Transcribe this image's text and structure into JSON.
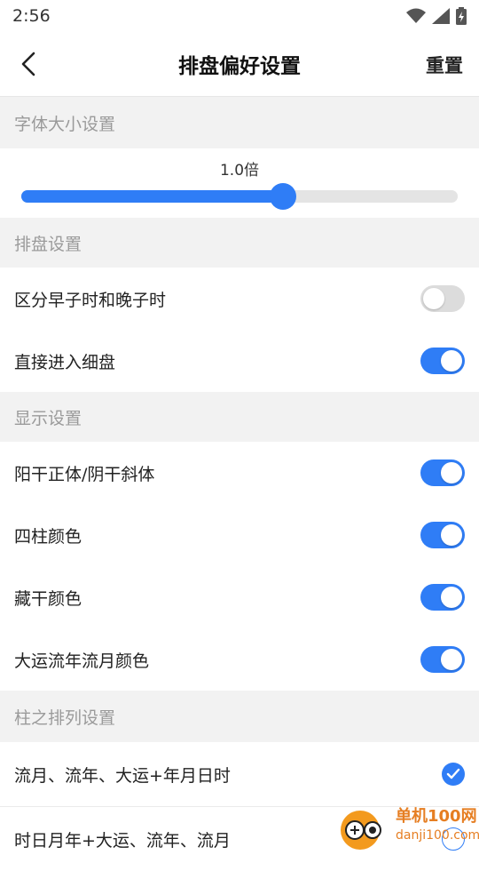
{
  "status_bar": {
    "time": "2:56",
    "icons": [
      "wifi-icon",
      "signal-icon",
      "battery-icon"
    ]
  },
  "navbar": {
    "title": "排盘偏好设置",
    "reset_label": "重置",
    "back_icon": "chevron-left-icon"
  },
  "font_size": {
    "header": "字体大小设置",
    "value_label": "1.0倍",
    "slider_percent": 60
  },
  "chart_settings": {
    "header": "排盘设置",
    "items": [
      {
        "label": "区分早子时和晚子时",
        "on": false
      },
      {
        "label": "直接进入细盘",
        "on": true
      }
    ]
  },
  "display_settings": {
    "header": "显示设置",
    "items": [
      {
        "label": "阳干正体/阴干斜体",
        "on": true
      },
      {
        "label": "四柱颜色",
        "on": true
      },
      {
        "label": "藏干颜色",
        "on": true
      },
      {
        "label": "大运流年流月颜色",
        "on": true
      }
    ]
  },
  "pillar_order": {
    "header": "柱之排列设置",
    "options": [
      {
        "label": "流月、流年、大运+年月日时",
        "selected": true
      },
      {
        "label": "时日月年+大运、流年、流月",
        "selected": false
      }
    ]
  },
  "watermark": {
    "text": "单机100网",
    "url_text": "danji100.com"
  },
  "colors": {
    "accent": "#2f7df6",
    "switch_off": "#dcdcdc",
    "section_bg": "#f2f2f2"
  }
}
